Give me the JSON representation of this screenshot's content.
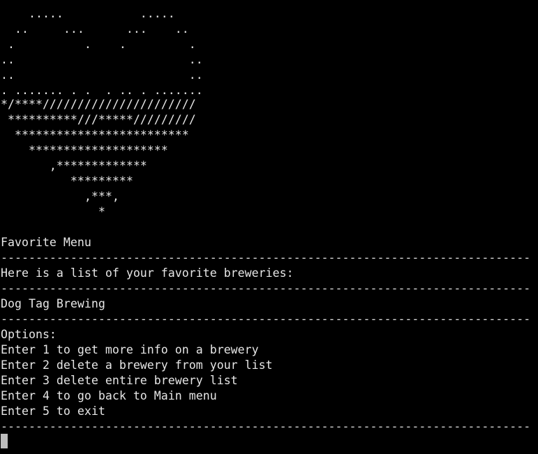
{
  "ascii_art": [
    "    .....           .....",
    "  ..     ...      ...    ..",
    " .          .    .         .",
    "..                         ..",
    "..                         ..",
    ". ....... . .  . .. . .......",
    "*/****//////////////////////",
    " **********///*****/////////",
    "  *************************",
    "    ********************",
    "       ,*************",
    "          *********",
    "            ,***,",
    "              *"
  ],
  "menu": {
    "title": "Favorite Menu",
    "divider": "----------------------------------------------------------------------------",
    "list_header": "Here is a list of your favorite breweries:",
    "breweries": [
      "Dog Tag Brewing"
    ],
    "options_label": "Options:",
    "options": [
      "Enter 1 to get more info on a brewery",
      "Enter 2 delete a brewery from your list",
      "Enter 3 delete entire brewery list",
      "Enter 4 to go back to Main menu",
      "Enter 5 to exit"
    ]
  },
  "colors": {
    "background": "#000000",
    "text": "#e6e6e6",
    "cursor": "#bdbdbd"
  }
}
